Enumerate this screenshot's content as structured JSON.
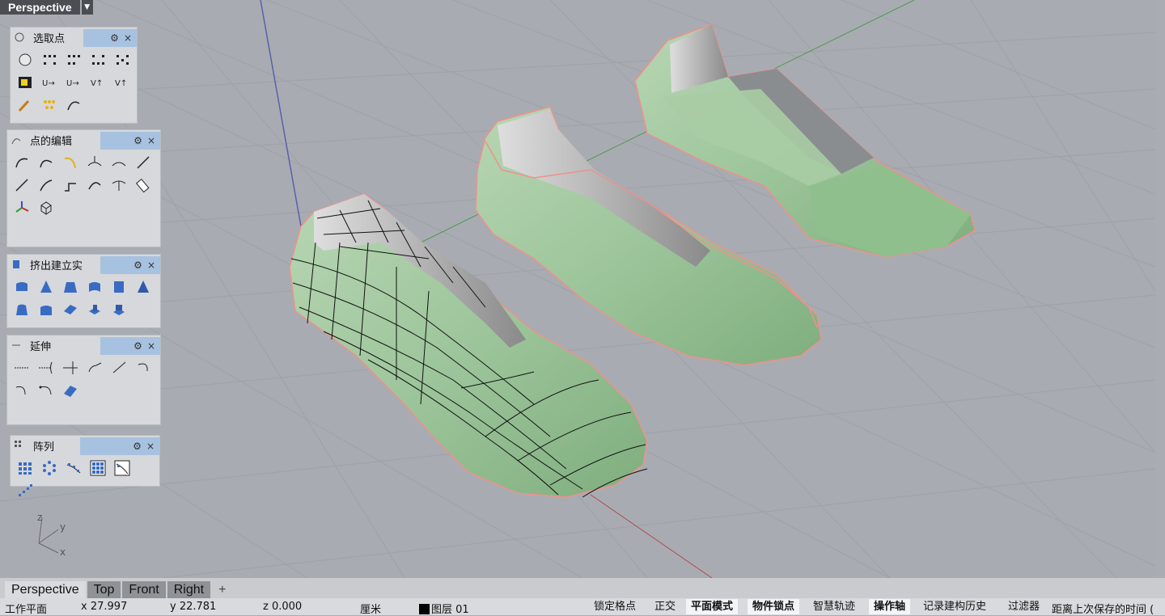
{
  "viewport": {
    "title": "Perspective"
  },
  "panels": [
    {
      "title": "选取点"
    },
    {
      "title": "点的编辑"
    },
    {
      "title": "挤出建立实"
    },
    {
      "title": "延伸"
    },
    {
      "title": "阵列"
    }
  ],
  "panel_buttons": {
    "gear": "⚙",
    "close": "×"
  },
  "axis_labels": {
    "z": "z",
    "y": "y",
    "x": "x"
  },
  "tabs": [
    "Perspective",
    "Top",
    "Front",
    "Right"
  ],
  "tab_add": "+",
  "status": {
    "cplane": "工作平面",
    "x": "x 27.997",
    "y": "y 22.781",
    "z": "z 0.000",
    "units": "厘米",
    "layer": "图层 01",
    "grid_snap": "锁定格点",
    "ortho": "正交",
    "planar": "平面模式",
    "osnap": "物件锁点",
    "smarttrack": "智慧轨迹",
    "gumball": "操作轴",
    "history": "记录建构历史",
    "filter": "过滤器",
    "autosave": "距离上次保存的时间 ("
  },
  "colors": {
    "viewport_bg": "#a8acb2",
    "surface": "#9cc49a",
    "highlight": "#f0908c",
    "active_tab": "#d9dbde"
  }
}
